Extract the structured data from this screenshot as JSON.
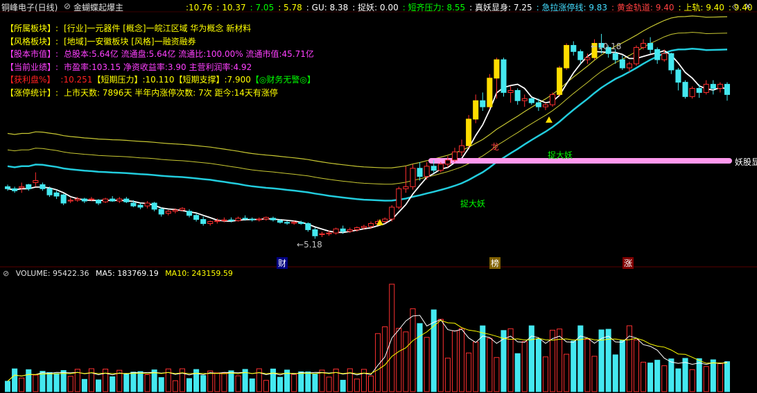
{
  "header": {
    "title": "铜峰电子(日线)",
    "indicator": "金蝴蝶起爆主",
    "values": [
      {
        "text": "10.76",
        "color": "#ffff00"
      },
      {
        "text": "10.37",
        "color": "#ffff00"
      },
      {
        "text": "7.05",
        "color": "#00ff00"
      },
      {
        "text": "5.78",
        "color": "#ffff00"
      },
      {
        "text": "GU: 8.38",
        "color": "#ffffff"
      },
      {
        "text": "捉妖: 0.00",
        "color": "#ffffff"
      },
      {
        "text": "短齐压力: 8.55",
        "color": "#00ff00"
      },
      {
        "text": "真妖显身: 7.25",
        "color": "#ffffff"
      },
      {
        "text": "急拉涨停线: 9.83",
        "color": "#44ddff"
      },
      {
        "text": "黄金轨道: 9.40",
        "color": "#ff4040"
      },
      {
        "text": "上轨: 9.40",
        "color": "#ffff00"
      },
      {
        "text": "9.40",
        "color": "#ffff00"
      }
    ]
  },
  "info": [
    {
      "label": "【所属板块】:",
      "label_color": "#ffff00",
      "text": "[行业]一元器件    [概念]一皖江区域 华为概念 新材料",
      "text_color": "#ffff00"
    },
    {
      "label": "【风格板块】:",
      "label_color": "#ffff00",
      "text": "[地域]一安徽板块    [风格]一融资融券",
      "text_color": "#ffff00"
    },
    {
      "label": "【股本市值】:",
      "label_color": "#ff40ff",
      "text": "总股本:5.64亿    流通盘:5.64亿    流通比:100.00%    流通市值:45.71亿",
      "text_color": "#ff40ff"
    },
    {
      "label": "【当前业绩】:",
      "label_color": "#ff40ff",
      "text": "市盈率:103.15   净资收益率:3.90    主营利润率:4.92",
      "text_color": "#ff40ff"
    },
    {
      "label": "【获利盘%】",
      "label_color": "#ff2020",
      "text": ":10.251",
      "text_color": "#ff2020",
      "extra": [
        {
          "text": "【短期压力】",
          "color": "#ffff00"
        },
        {
          "text": ":10.110",
          "color": "#ffff00"
        },
        {
          "text": "【短期支撑】",
          "color": "#ffff00"
        },
        {
          "text": ":7.900",
          "color": "#ffff00"
        },
        {
          "text": "【◎财务无警◎】",
          "color": "#00ff00"
        }
      ]
    },
    {
      "label": "【涨停统计】:",
      "label_color": "#ffff00",
      "text": "上市天数: 7896天 半年内涨停次数: 7次   距今:14天有涨停",
      "text_color": "#ffff00"
    }
  ],
  "annotations": {
    "high_label": "10.18",
    "low_label": "5.18",
    "tizhuo1": "捉大妖",
    "tizhuo2": "捉大妖",
    "yaogu": "妖股显",
    "long": "龙",
    "markers": [
      "财",
      "榜",
      "涨"
    ]
  },
  "volume": {
    "label": "VOLUME: 95422.36",
    "ma5": "MA5: 183769.19",
    "ma10": "MA10: 243159.59"
  },
  "chart_data": {
    "type": "candlestick",
    "price_range": [
      4.95,
      10.5
    ],
    "candles": [
      [
        6.45,
        6.5,
        6.4,
        6.35
      ],
      [
        6.4,
        6.45,
        6.35,
        6.3
      ],
      [
        6.42,
        6.55,
        6.45,
        6.3
      ],
      [
        6.5,
        6.52,
        6.4,
        6.35
      ],
      [
        6.55,
        6.8,
        6.6,
        6.45
      ],
      [
        6.5,
        6.55,
        6.4,
        6.35
      ],
      [
        6.4,
        6.45,
        6.25,
        6.2
      ],
      [
        6.3,
        6.35,
        6.22,
        6.15
      ],
      [
        6.25,
        6.28,
        6.05,
        6.0
      ],
      [
        6.1,
        6.18,
        6.12,
        6.05
      ],
      [
        6.12,
        6.2,
        6.15,
        6.08
      ],
      [
        6.15,
        6.18,
        6.1,
        6.05
      ],
      [
        6.15,
        6.2,
        6.15,
        6.1
      ],
      [
        6.12,
        6.15,
        6.05,
        6.0
      ],
      [
        6.08,
        6.18,
        6.15,
        6.05
      ],
      [
        6.15,
        6.22,
        6.1,
        6.08
      ],
      [
        6.1,
        6.2,
        6.15,
        6.05
      ],
      [
        6.15,
        6.2,
        6.08,
        6.05
      ],
      [
        6.05,
        6.12,
        5.98,
        5.95
      ],
      [
        6.0,
        6.05,
        5.95,
        5.9
      ],
      [
        5.98,
        6.1,
        6.05,
        5.92
      ],
      [
        6.05,
        6.08,
        5.9,
        5.85
      ],
      [
        5.9,
        5.95,
        5.78,
        5.72
      ],
      [
        5.8,
        5.88,
        5.85,
        5.75
      ],
      [
        5.85,
        5.92,
        5.88,
        5.8
      ],
      [
        5.88,
        5.95,
        5.92,
        5.85
      ],
      [
        5.85,
        5.9,
        5.75,
        5.7
      ],
      [
        5.75,
        5.8,
        5.65,
        5.6
      ],
      [
        5.65,
        5.72,
        5.55,
        5.5
      ],
      [
        5.55,
        5.62,
        5.6,
        5.5
      ],
      [
        5.6,
        5.68,
        5.62,
        5.55
      ],
      [
        5.62,
        5.7,
        5.64,
        5.58
      ],
      [
        5.64,
        5.7,
        5.62,
        5.58
      ],
      [
        5.62,
        5.72,
        5.68,
        5.6
      ],
      [
        5.68,
        5.75,
        5.66,
        5.62
      ],
      [
        5.66,
        5.7,
        5.64,
        5.6
      ],
      [
        5.64,
        5.7,
        5.66,
        5.6
      ],
      [
        5.66,
        5.72,
        5.7,
        5.62
      ],
      [
        5.68,
        5.72,
        5.64,
        5.6
      ],
      [
        5.62,
        5.66,
        5.58,
        5.55
      ],
      [
        5.58,
        5.62,
        5.56,
        5.52
      ],
      [
        5.56,
        5.62,
        5.58,
        5.52
      ],
      [
        5.58,
        5.62,
        5.55,
        5.52
      ],
      [
        5.55,
        5.58,
        5.4,
        5.35
      ],
      [
        5.4,
        5.45,
        5.25,
        5.18
      ],
      [
        5.28,
        5.35,
        5.3,
        5.22
      ],
      [
        5.3,
        5.38,
        5.32,
        5.25
      ],
      [
        5.32,
        5.45,
        5.42,
        5.28
      ],
      [
        5.42,
        5.5,
        5.36,
        5.3
      ],
      [
        5.36,
        5.45,
        5.4,
        5.32
      ],
      [
        5.4,
        5.48,
        5.45,
        5.35
      ],
      [
        5.45,
        5.52,
        5.48,
        5.4
      ],
      [
        5.48,
        5.6,
        5.55,
        5.42
      ],
      [
        5.55,
        5.65,
        5.6,
        5.5
      ],
      [
        5.6,
        5.7,
        5.66,
        5.55
      ],
      [
        5.66,
        6.0,
        5.95,
        5.6
      ],
      [
        5.95,
        6.45,
        6.4,
        5.9
      ],
      [
        6.4,
        6.95,
        6.45,
        6.3
      ],
      [
        6.45,
        7.0,
        6.9,
        6.38
      ],
      [
        6.9,
        7.05,
        6.7,
        6.6
      ],
      [
        6.7,
        7.05,
        6.95,
        6.62
      ],
      [
        6.95,
        7.1,
        6.85,
        6.78
      ],
      [
        6.85,
        7.05,
        7.0,
        6.8
      ],
      [
        7.0,
        7.2,
        7.1,
        6.92
      ],
      [
        7.1,
        7.4,
        7.3,
        7.05
      ],
      [
        7.3,
        7.6,
        7.45,
        7.2
      ],
      [
        7.45,
        8.2,
        8.1,
        7.4
      ],
      [
        8.1,
        8.7,
        8.55,
        8.0
      ],
      [
        8.55,
        8.75,
        8.4,
        8.3
      ],
      [
        8.4,
        9.2,
        9.1,
        8.35
      ],
      [
        9.1,
        9.6,
        9.55,
        8.6
      ],
      [
        9.55,
        9.6,
        8.75,
        8.65
      ],
      [
        8.75,
        8.9,
        8.8,
        8.5
      ],
      [
        8.8,
        8.85,
        8.55,
        8.45
      ],
      [
        8.55,
        8.7,
        8.6,
        8.4
      ],
      [
        8.6,
        8.62,
        8.5,
        8.45
      ],
      [
        8.5,
        8.6,
        8.4,
        8.3
      ],
      [
        8.4,
        8.5,
        8.45,
        8.32
      ],
      [
        8.45,
        8.75,
        8.7,
        8.4
      ],
      [
        8.7,
        9.4,
        9.35,
        8.65
      ],
      [
        9.35,
        9.95,
        9.9,
        9.3
      ],
      [
        9.9,
        10.0,
        9.75,
        9.65
      ],
      [
        9.75,
        9.8,
        9.55,
        9.45
      ],
      [
        9.55,
        9.7,
        9.6,
        9.45
      ],
      [
        9.6,
        10.05,
        9.95,
        9.55
      ],
      [
        9.95,
        10.18,
        9.85,
        9.7
      ],
      [
        9.85,
        9.9,
        9.7,
        9.6
      ],
      [
        9.7,
        9.8,
        9.55,
        9.45
      ],
      [
        9.55,
        9.65,
        9.35,
        9.3
      ],
      [
        9.35,
        9.5,
        9.45,
        9.25
      ],
      [
        9.45,
        9.9,
        9.85,
        9.4
      ],
      [
        9.85,
        10.05,
        9.95,
        9.8
      ],
      [
        9.95,
        10.1,
        9.8,
        9.7
      ],
      [
        9.8,
        9.85,
        9.55,
        9.45
      ],
      [
        9.55,
        9.8,
        9.7,
        9.5
      ],
      [
        9.7,
        9.72,
        9.3,
        9.2
      ],
      [
        9.3,
        9.35,
        9.0,
        8.8
      ],
      [
        9.0,
        9.05,
        8.65,
        8.6
      ],
      [
        8.65,
        8.9,
        8.85,
        8.6
      ],
      [
        8.85,
        8.95,
        8.75,
        8.62
      ],
      [
        8.75,
        9.05,
        8.95,
        8.7
      ],
      [
        8.95,
        9.05,
        8.85,
        8.7
      ],
      [
        8.85,
        9.0,
        8.95,
        8.75
      ],
      [
        8.95,
        9.0,
        8.7,
        8.55
      ]
    ],
    "volume_range": [
      0,
      160000
    ]
  }
}
